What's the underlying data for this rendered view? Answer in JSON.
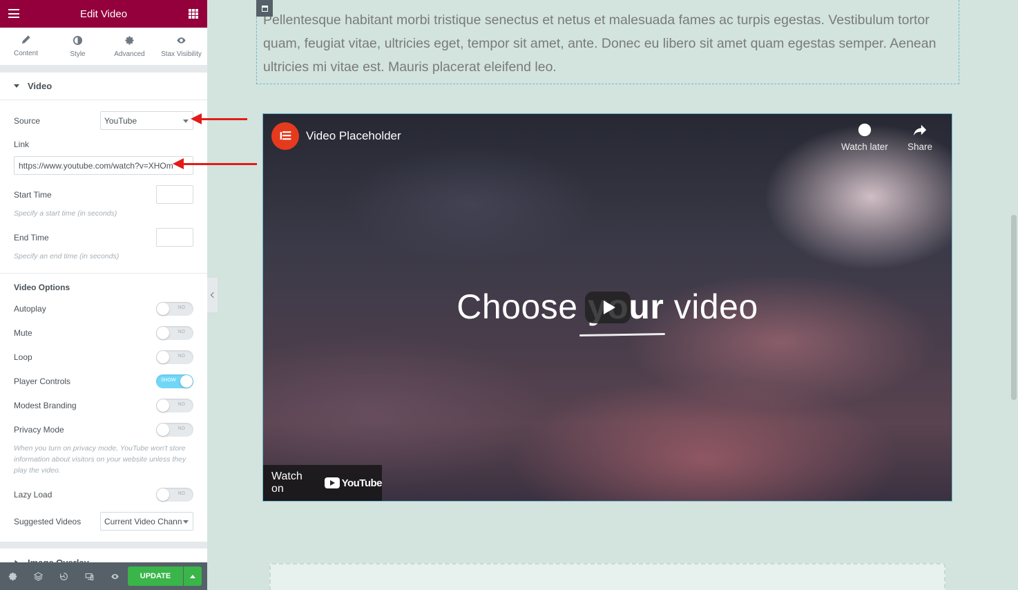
{
  "editor": {
    "title": "Edit Video",
    "tabs": [
      {
        "label": "Content",
        "icon": "pencil-icon"
      },
      {
        "label": "Style",
        "icon": "half-circle-icon"
      },
      {
        "label": "Advanced",
        "icon": "gear-icon"
      },
      {
        "label": "Stax Visibility",
        "icon": "eye-icon"
      }
    ],
    "active_tab": "Content",
    "section_video": "Video",
    "source": {
      "label": "Source",
      "value": "YouTube"
    },
    "link": {
      "label": "Link",
      "value": "https://www.youtube.com/watch?v=XHOm"
    },
    "start_time": {
      "label": "Start Time",
      "help": "Specify a start time (in seconds)"
    },
    "end_time": {
      "label": "End Time",
      "help": "Specify an end time (in seconds)"
    },
    "video_options_heading": "Video Options",
    "toggles": [
      {
        "label": "Autoplay",
        "state": "NO",
        "on": false
      },
      {
        "label": "Mute",
        "state": "NO",
        "on": false
      },
      {
        "label": "Loop",
        "state": "NO",
        "on": false
      },
      {
        "label": "Player Controls",
        "state": "SHOW",
        "on": true
      },
      {
        "label": "Modest Branding",
        "state": "NO",
        "on": false
      },
      {
        "label": "Privacy Mode",
        "state": "NO",
        "on": false
      }
    ],
    "privacy_help": "When you turn on privacy mode, YouTube won't store information about visitors on your website unless they play the video.",
    "lazy_load": {
      "label": "Lazy Load",
      "state": "NO"
    },
    "suggested_videos": {
      "label": "Suggested Videos",
      "value": "Current Video Chann"
    },
    "section_image_overlay": "Image Overlay",
    "update_label": "UPDATE"
  },
  "canvas": {
    "paragraph": "Pellentesque habitant morbi tristique senectus et netus et malesuada fames ac turpis egestas. Vestibulum tortor quam, feugiat vitae, ultricies eget, tempor sit amet, ante. Donec eu libero sit amet quam egestas semper. Aenean ultricies mi vitae est. Mauris placerat eleifend leo.",
    "video": {
      "title": "Video Placeholder",
      "watch_later": "Watch later",
      "share": "Share",
      "headline_pre": "Choose ",
      "headline_bold": "your",
      "headline_post": " video",
      "watch_on": "Watch on",
      "brand": "YouTube"
    }
  },
  "colors": {
    "topbar": "#93003c",
    "canvas_bg": "#d2e4dd",
    "update_button": "#39b54a",
    "annotation_arrow": "#e21b1b"
  }
}
